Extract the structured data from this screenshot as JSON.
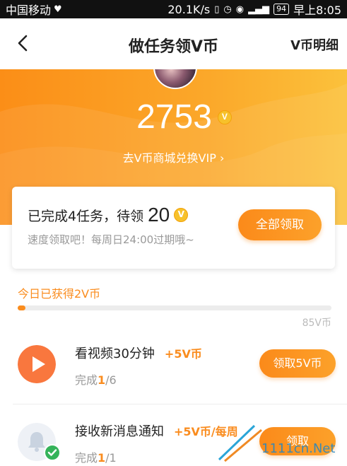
{
  "status_bar": {
    "carrier": "中国移动",
    "speed": "20.1K/s",
    "battery": "94",
    "time": "早上8:05"
  },
  "nav": {
    "title": "做任务领V币",
    "right_label": "V币明细"
  },
  "hero": {
    "coins": "2753",
    "coin_symbol": "V",
    "exchange_link": "去V币商城兑换VIP"
  },
  "summary_card": {
    "title_prefix": "已完成4任务，待领",
    "pending": "20",
    "subtitle": "速度领取吧！每周日24:00过期哦~",
    "claim_all_label": "全部领取"
  },
  "progress": {
    "label": "今日已获得2V币",
    "current": 2,
    "max": 85,
    "max_label": "85V币"
  },
  "tasks": [
    {
      "name": "看视频30分钟",
      "reward": "+5V币",
      "progress_prefix": "完成",
      "done": "1",
      "total": "/6",
      "button": "领取5V币",
      "icon": "play-icon"
    },
    {
      "name": "接收新消息通知",
      "reward": "+5V币/每周",
      "progress_prefix": "完成",
      "done": "1",
      "total": "/1",
      "button": "领取",
      "icon": "bell-icon"
    }
  ],
  "watermark": "1111cn.Net",
  "colors": {
    "accent": "#fa8c1e",
    "hero_gradient_start": "#fb8e17",
    "hero_gradient_end": "#fbc13b"
  }
}
